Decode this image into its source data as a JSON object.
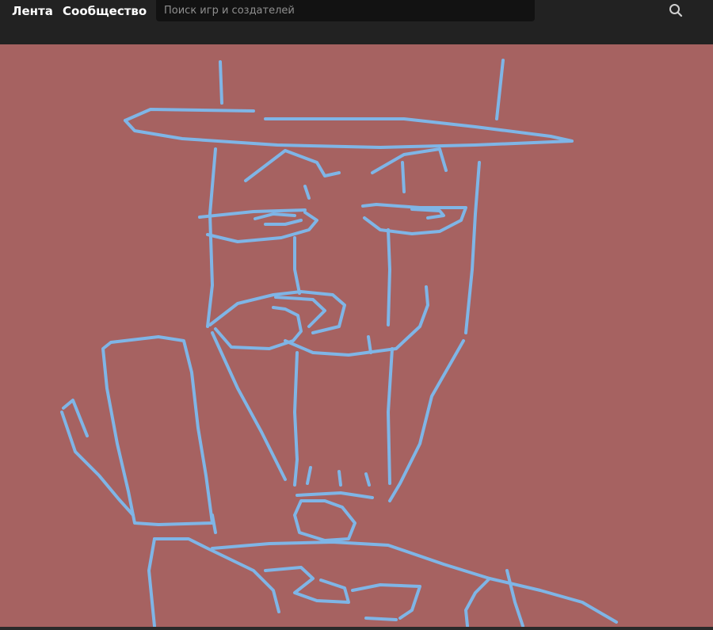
{
  "nav": {
    "feed_label": "Лента",
    "community_label": "Сообщество"
  },
  "search": {
    "placeholder": "Поиск игр и создателей",
    "value": ""
  },
  "icons": {
    "search": "search-icon"
  },
  "colors": {
    "topbar": "#222222",
    "search_bg": "#121212",
    "canvas_bg": "#a66261",
    "stroke": "#7fb5e6"
  }
}
